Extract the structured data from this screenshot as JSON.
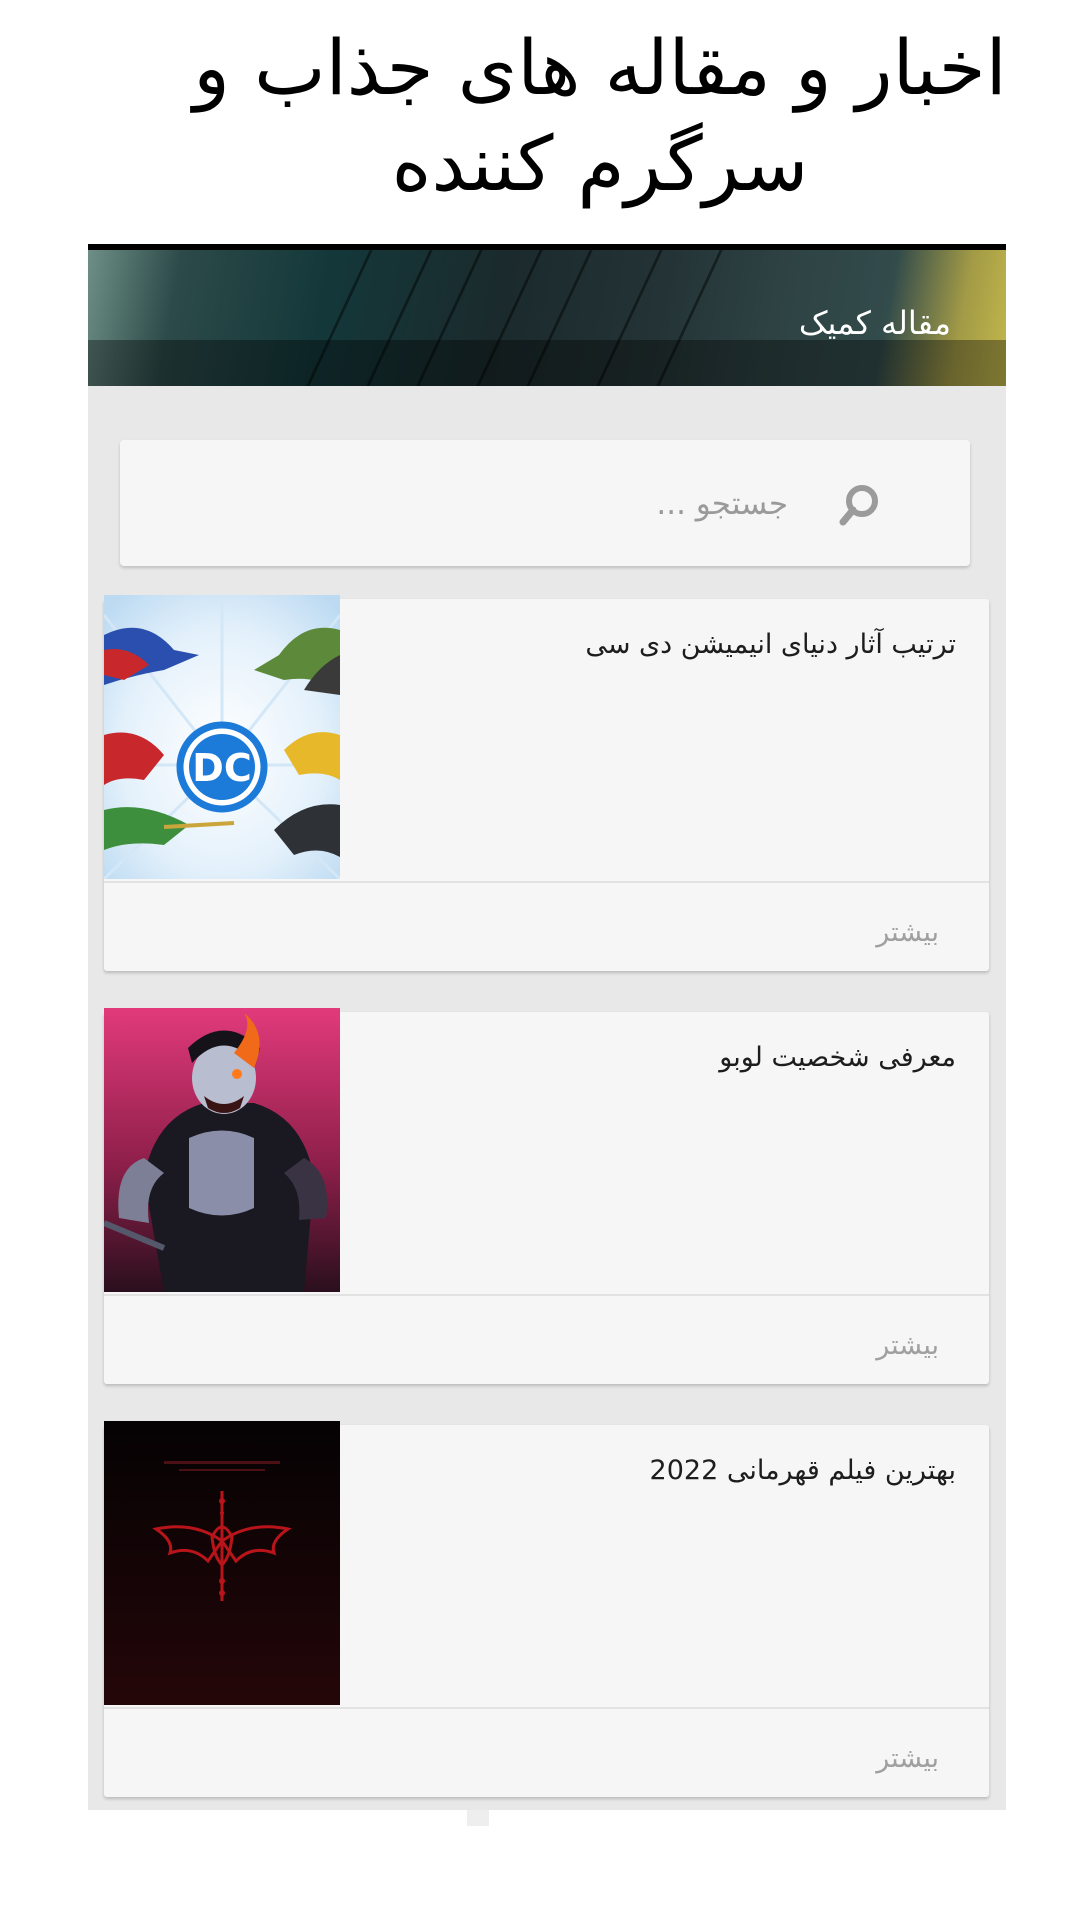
{
  "headline": {
    "line1": "اخبار و مقاله های جذاب و",
    "line2": "سرگرم کننده"
  },
  "banner": {
    "title": "مقاله کمیک"
  },
  "search": {
    "placeholder": "جستجو ...",
    "icon": "search-icon"
  },
  "articles": [
    {
      "title": "ترتیب آثار دنیای انیمیشن دی سی",
      "more_label": "بیشتر",
      "thumb_logo": "DC"
    },
    {
      "title": "معرفی شخصیت لوبو",
      "more_label": "بیشتر"
    },
    {
      "title": "بهترین فیلم قهرمانی 2022",
      "more_label": "بیشتر"
    }
  ],
  "colors": {
    "page_bg": "#ffffff",
    "app_bg": "#e8e8e8",
    "card_bg": "#f6f6f6",
    "more_text": "#a0a0a0",
    "dc_blue": "#1c7ad8"
  }
}
